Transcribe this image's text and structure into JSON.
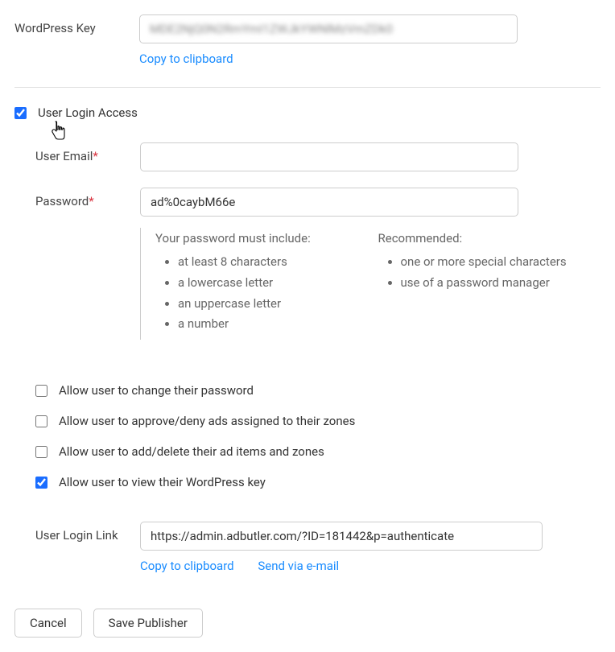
{
  "wordpress_key": {
    "label": "WordPress Key",
    "value_blurred": "MDE2NjQ0N2RmYmI1ZWJkYWNlMzVmZDk0",
    "copy_label": "Copy to clipboard"
  },
  "user_login_access": {
    "label": "User Login Access",
    "checked": true
  },
  "user_email": {
    "label": "User Email",
    "required": "*",
    "value": ""
  },
  "password": {
    "label": "Password",
    "required": "*",
    "value": "ad%0caybM66e",
    "rules": {
      "must_heading": "Your password must include:",
      "must_items": [
        "at least 8 characters",
        "a lowercase letter",
        "an uppercase letter",
        "a number"
      ],
      "rec_heading": "Recommended:",
      "rec_items": [
        "one or more special characters",
        "use of a password manager"
      ]
    }
  },
  "permissions": [
    {
      "label": "Allow user to change their password",
      "checked": false
    },
    {
      "label": "Allow user to approve/deny ads assigned to their zones",
      "checked": false
    },
    {
      "label": "Allow user to add/delete their ad items and zones",
      "checked": false
    },
    {
      "label": "Allow user to view their WordPress key",
      "checked": true
    }
  ],
  "login_link": {
    "label": "User Login Link",
    "value": "https://admin.adbutler.com/?ID=181442&p=authenticate",
    "copy_label": "Copy to clipboard",
    "send_label": "Send via e-mail"
  },
  "buttons": {
    "cancel": "Cancel",
    "save": "Save Publisher"
  }
}
